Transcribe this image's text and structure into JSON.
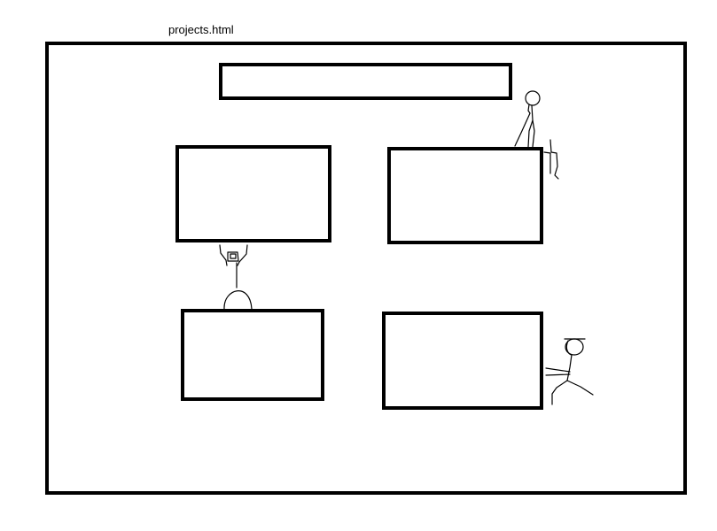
{
  "page": {
    "filename": "projects.html"
  },
  "wireframe": {
    "header_bar": "",
    "project_cards": [
      "",
      "",
      "",
      ""
    ]
  },
  "colors": {
    "stroke": "#000000",
    "background": "#ffffff"
  }
}
